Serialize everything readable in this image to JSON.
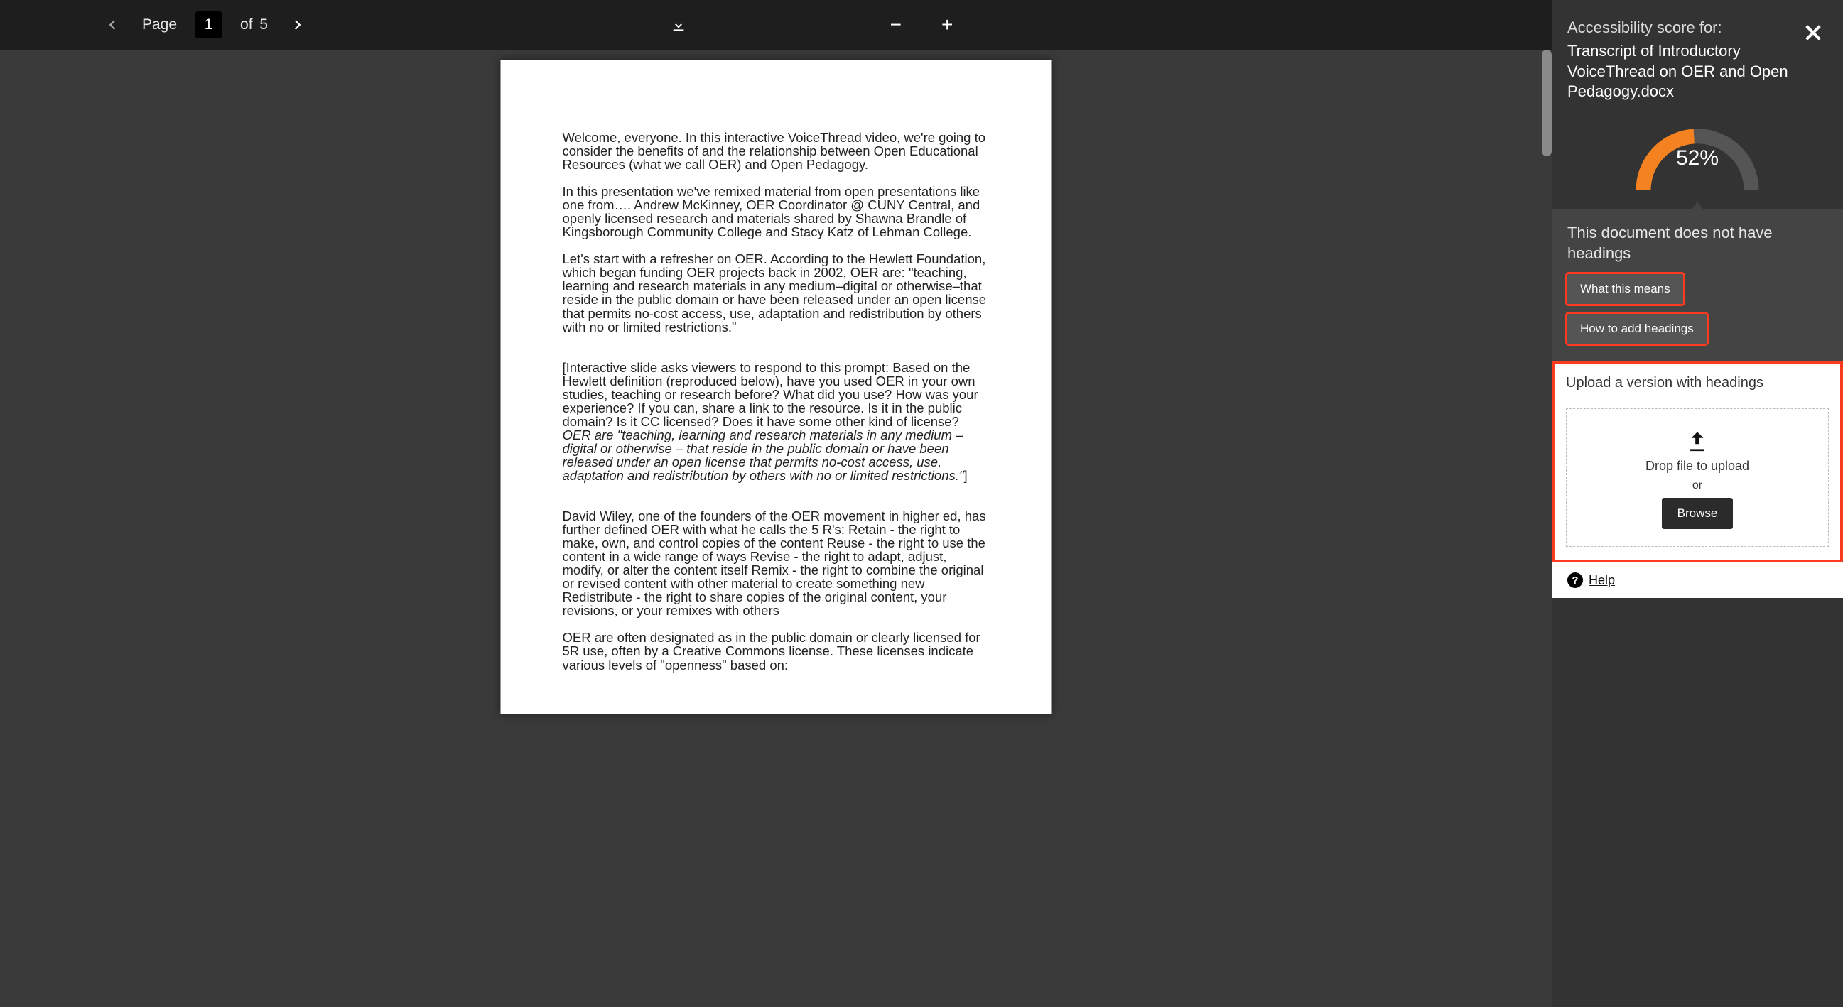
{
  "toolbar": {
    "page_label": "Page",
    "current_page": "1",
    "of_label": "of",
    "total_pages": "5"
  },
  "document": {
    "para1": "Welcome, everyone. In this interactive VoiceThread video, we're going to consider the benefits of and the relationship between Open Educational Resources (what we call OER) and Open Pedagogy.",
    "para2": "In this presentation we've remixed material from open presentations like one from…. Andrew McKinney, OER Coordinator @ CUNY Central, and openly licensed research and materials shared by Shawna Brandle of Kingsborough Community College and Stacy Katz of Lehman College.",
    "para3": "Let's start with a refresher on OER. According to the Hewlett Foundation, which began funding OER projects back in 2002, OER are: \"teaching, learning and research materials in any medium–digital or otherwise–that reside in the public domain or have been released under an open license that permits no-cost access, use, adaptation and redistribution by others with no or limited restrictions.\"",
    "para4_plain": "[Interactive slide asks viewers to respond to this prompt: Based on the Hewlett definition (reproduced below), have you used OER in your own studies, teaching or research before? What did you use? How was your experience? If you can, share a link to the resource. Is it in the public domain? Is it CC licensed? Does it have some other kind of license? ",
    "para4_italic": "OER are \"teaching, learning and research materials in any medium – digital or otherwise – that reside in the public domain or have been released under an open license that permits no-cost access, use, adaptation and redistribution by others with no or limited restrictions.\"",
    "para4_close": "]",
    "para5": "David Wiley, one of the founders of the OER movement in higher ed, has further defined OER with what he calls the 5 R's: Retain - the right to make, own, and control copies of the content Reuse - the right to use the content in a wide range of ways Revise - the right to adapt, adjust, modify, or alter the content itself Remix - the right to combine the original or revised content with other material to create something new Redistribute - the right to share copies of the original content, your revisions, or your remixes with others",
    "para6": "OER are often designated as in the public domain or clearly licensed for 5R use, often by a Creative Commons license. These licenses indicate various levels of \"openness\" based on:"
  },
  "panel": {
    "score_label": "Accessibility score for:",
    "filename": "Transcript of Introductory VoiceThread on OER and Open Pedagogy.docx",
    "score_text": "52%",
    "issue_heading": "This document does not have headings",
    "what_means_label": "What this means",
    "how_to_label": "How to add headings",
    "upload_title": "Upload a version with headings",
    "drop_text": "Drop file to upload",
    "or_text": "or",
    "browse_label": "Browse",
    "help_label": "Help"
  },
  "chart_data": {
    "type": "gauge",
    "value": 52,
    "min": 0,
    "max": 100,
    "unit": "%",
    "title": "Accessibility score",
    "color_filled": "#f58220",
    "color_track": "#555"
  }
}
